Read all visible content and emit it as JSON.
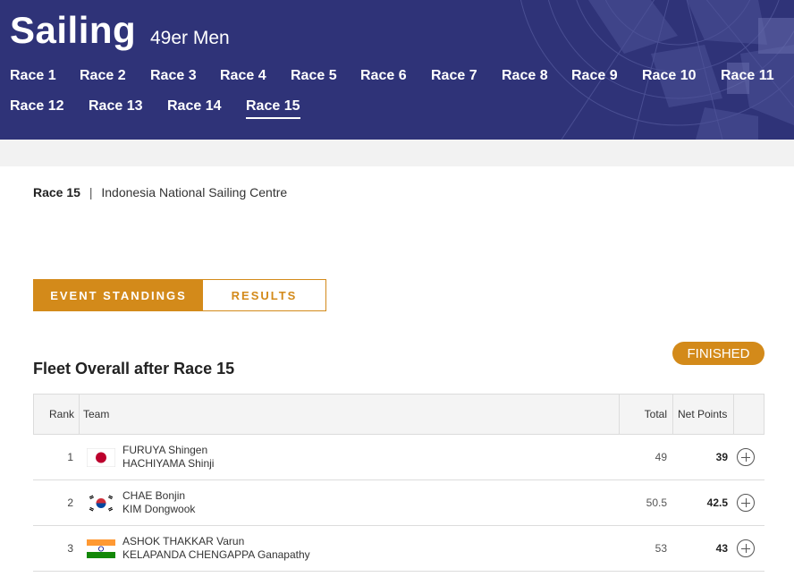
{
  "header": {
    "sport": "Sailing",
    "event": "49er Men",
    "races": [
      "Race 1",
      "Race 2",
      "Race 3",
      "Race 4",
      "Race 5",
      "Race 6",
      "Race 7",
      "Race 8",
      "Race 9",
      "Race 10",
      "Race 11",
      "Race 12",
      "Race 13",
      "Race 14",
      "Race 15"
    ],
    "active_race": "Race 15"
  },
  "venue": {
    "race": "Race 15",
    "separator": "|",
    "location": "Indonesia National Sailing Centre"
  },
  "toggle": {
    "standings_label": "EVENT STANDINGS",
    "results_label": "RESULTS",
    "active": "standings"
  },
  "standings": {
    "title": "Fleet Overall after Race 15",
    "status": "FINISHED",
    "columns": {
      "rank": "Rank",
      "team": "Team",
      "total": "Total",
      "net": "Net Points"
    },
    "rows": [
      {
        "rank": "1",
        "flag": "japan-flag-icon",
        "sailors": [
          "FURUYA Shingen",
          "HACHIYAMA Shinji"
        ],
        "total": "49",
        "net": "39"
      },
      {
        "rank": "2",
        "flag": "korea-flag-icon",
        "sailors": [
          "CHAE Bonjin",
          "KIM Dongwook"
        ],
        "total": "50.5",
        "net": "42.5"
      },
      {
        "rank": "3",
        "flag": "india-flag-icon",
        "sailors": [
          "ASHOK THAKKAR Varun",
          "KELAPANDA CHENGAPPA Ganapathy"
        ],
        "total": "53",
        "net": "43"
      }
    ]
  },
  "colors": {
    "header_bg": "#2f3378",
    "accent": "#d38a1a"
  }
}
